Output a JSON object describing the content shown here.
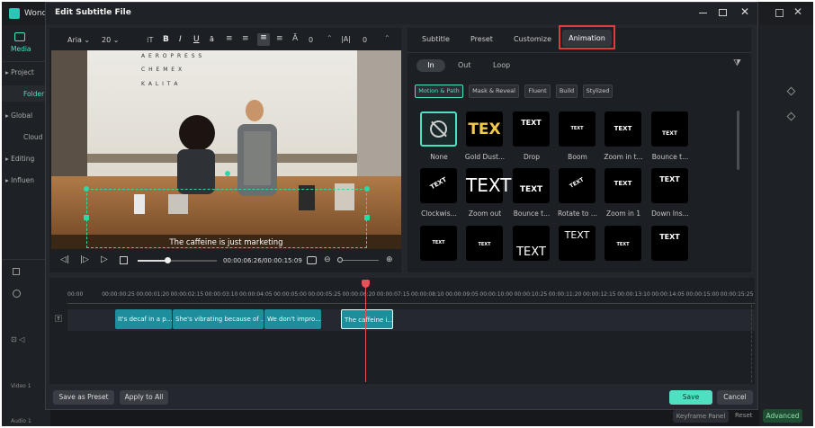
{
  "app": {
    "title": "Wonde",
    "media_tab": "Media",
    "sidebar": [
      "Project",
      "Folder",
      "Global",
      "Cloud",
      "Editing",
      "Influen"
    ],
    "track_labels": [
      "Video 1",
      "Audio 1"
    ],
    "bottom_buttons": {
      "keyframe": "Keyframe Panel",
      "reset": "Reset",
      "advanced": "Advanced"
    }
  },
  "dialog": {
    "title": "Edit Subtitle File",
    "toolbar": {
      "font": "Aria",
      "font_size": "20",
      "spacing_value": "0",
      "line_value": "0"
    },
    "preview": {
      "subtitle": "The caffeine is just marketing",
      "store_sign": [
        "A E R O P R E S S",
        "C H E M E X",
        "K A L I T A"
      ]
    },
    "playback": {
      "time": "00:00:06:26/00:00:15:09",
      "progress": 0.37
    },
    "panel_tabs": [
      "Subtitle",
      "Preset",
      "Customize",
      "Animation"
    ],
    "active_tab": "Animation",
    "subtabs": [
      "In",
      "Out",
      "Loop"
    ],
    "active_subtab": "In",
    "categories": [
      "Motion & Path",
      "Mask & Reveal",
      "Fluent",
      "Build",
      "Stylized"
    ],
    "active_category": "Motion & Path",
    "animations": [
      {
        "label": "None",
        "thumb": ""
      },
      {
        "label": "Gold Dust...",
        "thumb": "TEX"
      },
      {
        "label": "Drop",
        "thumb": "TEXT"
      },
      {
        "label": "Boom",
        "thumb": "TEXT"
      },
      {
        "label": "Zoom in t...",
        "thumb": "TEXT"
      },
      {
        "label": "Bounce t...",
        "thumb": "TEXT"
      },
      {
        "label": "Clockwis...",
        "thumb": "TEXT"
      },
      {
        "label": "Zoom out",
        "thumb": "TEXT"
      },
      {
        "label": "Bounce t...",
        "thumb": "TEXT"
      },
      {
        "label": "Rotate to ...",
        "thumb": "TEXT"
      },
      {
        "label": "Zoom in 1",
        "thumb": "TEXT"
      },
      {
        "label": "Down Ins...",
        "thumb": "TEXT"
      },
      {
        "label": "",
        "thumb": "TEXT"
      },
      {
        "label": "",
        "thumb": "TEXT"
      },
      {
        "label": "",
        "thumb": "TEXT"
      },
      {
        "label": "",
        "thumb": "TEXT"
      },
      {
        "label": "",
        "thumb": "TEXT"
      },
      {
        "label": "",
        "thumb": "TEXT"
      }
    ],
    "timeline": {
      "ticks": [
        "00:00",
        "00:00:00:25",
        "00:00:01:20",
        "00:00:02:15",
        "00:00:03:10",
        "00:00:04:05",
        "00:00:05:00",
        "00:00:05:25",
        "00:00:06:20",
        "00:00:07:15",
        "00:00:08:10",
        "00:00:09:05",
        "00:00:10:00",
        "00:00:10:25",
        "00:00:11:20",
        "00:00:12:15",
        "00:00:13:10",
        "00:00:14:05",
        "00:00:15:00",
        "00:00:15:25"
      ],
      "clips": [
        "It's decaf in a p...",
        "She's vibrating because of ...",
        "We don't impro...",
        "The caffeine i..."
      ]
    },
    "footer": {
      "save_preset": "Save as Preset",
      "apply_all": "Apply to All",
      "save": "Save",
      "cancel": "Cancel"
    },
    "colors": {
      "accent": "#4fe0c2",
      "clip": "#1e8d9c",
      "playhead": "#e8505b",
      "highlight": "#e03a3a"
    }
  }
}
